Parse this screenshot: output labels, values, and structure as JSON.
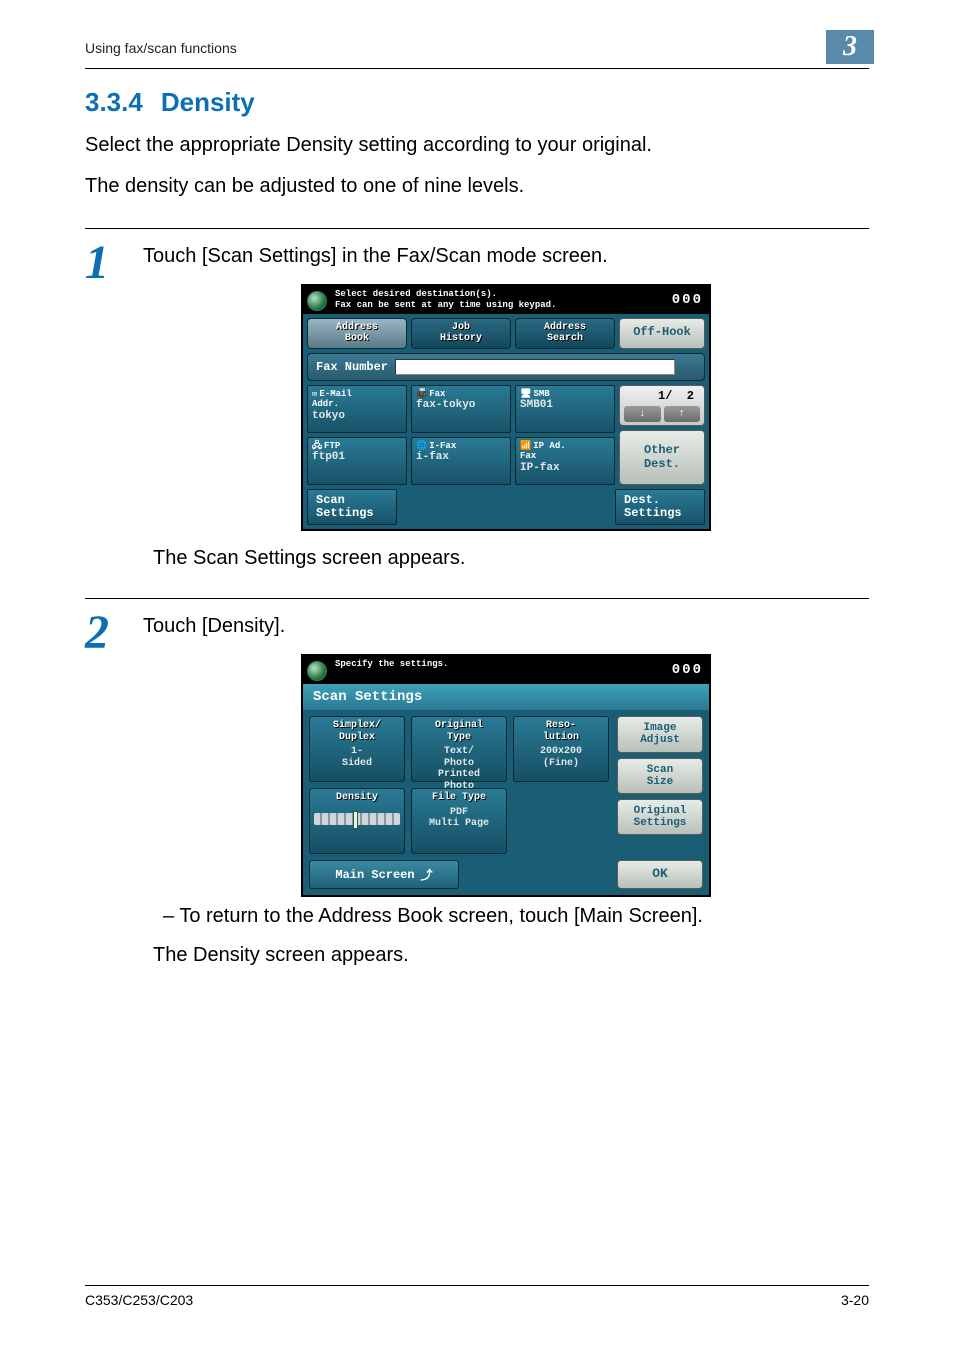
{
  "header": {
    "breadcrumb": "Using fax/scan functions",
    "chapter_number": "3"
  },
  "section": {
    "number": "3.3.4",
    "title": "Density",
    "para1": "Select the appropriate Density setting according to your original.",
    "para2": "The density can be adjusted to one of nine levels."
  },
  "step1": {
    "number": "1",
    "text": "Touch [Scan Settings] in the Fax/Scan mode screen.",
    "after": "The Scan Settings screen appears.",
    "panel": {
      "msg1": "Select desired destination(s).",
      "msg2": "Fax can be sent at any time using keypad.",
      "count": "000",
      "tab_addressbook": "Address\nBook",
      "tab_jobhistory": "Job\nHistory",
      "tab_addresssearch": "Address\nSearch",
      "off_hook": "Off-Hook",
      "fax_number_label": "Fax Number",
      "dest": [
        {
          "icon": "email-icon",
          "label": "E-Mail\nAddr.",
          "value": "tokyo"
        },
        {
          "icon": "fax-icon",
          "label": "Fax",
          "value": "fax-tokyo"
        },
        {
          "icon": "smb-icon",
          "label": "SMB",
          "value": "SMB01"
        },
        {
          "icon": "ftp-icon",
          "label": "FTP",
          "value": "ftp01"
        },
        {
          "icon": "ifax-icon",
          "label": "I-Fax",
          "value": "i-fax"
        },
        {
          "icon": "ipfax-icon",
          "label": "IP Ad.\nFax",
          "value": "IP-fax"
        }
      ],
      "pager": {
        "current": "1",
        "total": "2",
        "sep": "/"
      },
      "other_dest": "Other\nDest.",
      "scan_settings": "Scan\nSettings",
      "dest_settings": "Dest.\nSettings"
    }
  },
  "step2": {
    "number": "2",
    "text": "Touch [Density].",
    "sub": "– To return to the Address Book screen, touch [Main Screen].",
    "after": "The Density screen appears.",
    "panel": {
      "msg1": "Specify the settings.",
      "count": "000",
      "header": "Scan Settings",
      "cells": {
        "simplex": {
          "hd": "Simplex/\nDuplex",
          "val": "1-\nSided"
        },
        "original_type": {
          "hd": "Original\nType",
          "val": "Text/\nPhoto\nPrinted\nPhoto"
        },
        "resolution": {
          "hd": "Reso-\nlution",
          "val": "200x200\n(Fine)"
        },
        "density": {
          "hd": "Density"
        },
        "file_type": {
          "hd": "File Type",
          "val": "PDF\nMulti Page"
        }
      },
      "right": {
        "image_adjust": "Image\nAdjust",
        "scan_size": "Scan\nSize",
        "original_settings": "Original\nSettings"
      },
      "main_screen": "Main Screen",
      "ok": "OK"
    }
  },
  "footer": {
    "model": "C353/C253/C203",
    "page": "3-20"
  }
}
